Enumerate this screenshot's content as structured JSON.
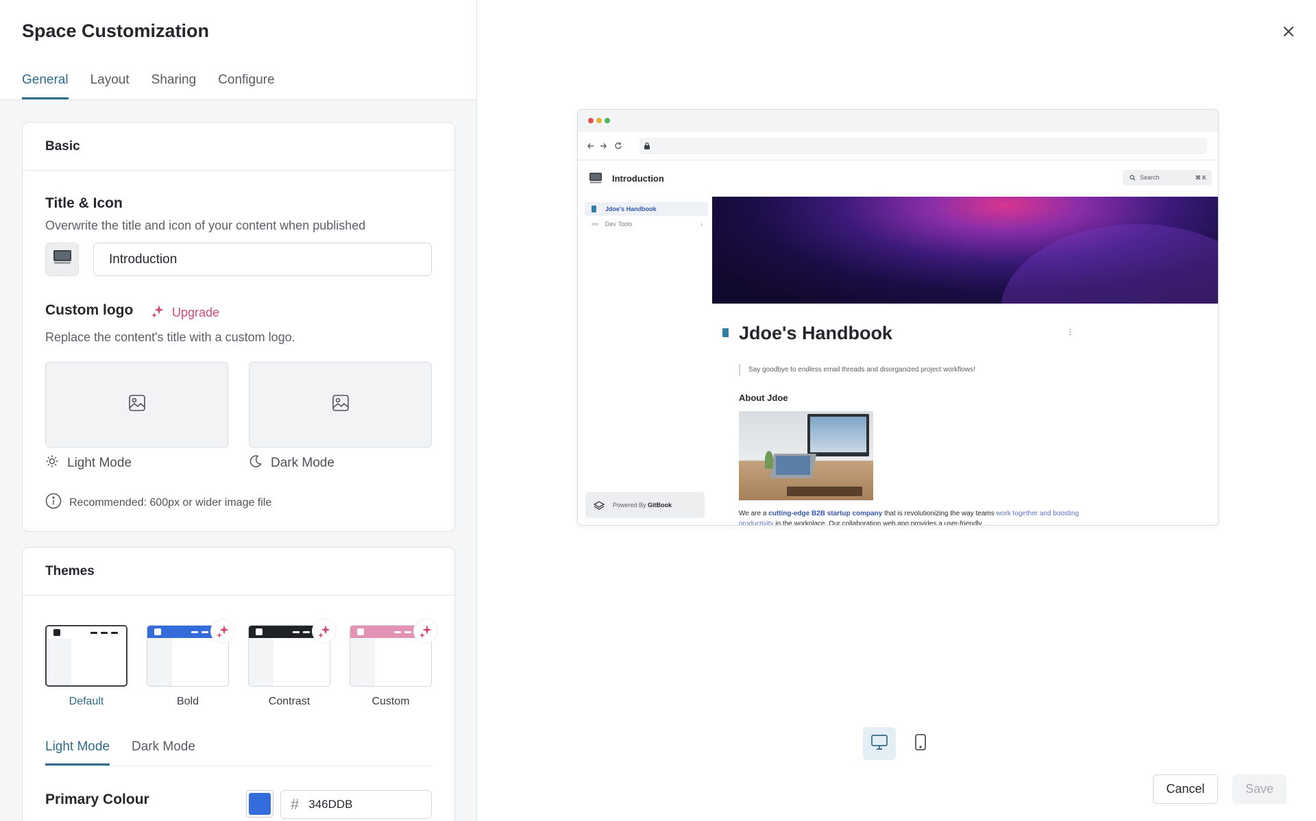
{
  "panel": {
    "title": "Space Customization",
    "tabs": [
      {
        "label": "General",
        "active": true
      },
      {
        "label": "Layout"
      },
      {
        "label": "Sharing"
      },
      {
        "label": "Configure"
      }
    ]
  },
  "basic": {
    "header": "Basic",
    "title_icon_heading": "Title & Icon",
    "title_icon_sub": "Overwrite the title and icon of your content when published",
    "title_value": "Introduction",
    "custom_logo_heading": "Custom logo",
    "upgrade_label": "Upgrade",
    "custom_logo_sub": "Replace the content's title with a custom logo.",
    "light_mode_label": "Light Mode",
    "dark_mode_label": "Dark Mode",
    "recommendation": "Recommended: 600px or wider image file"
  },
  "themes": {
    "header": "Themes",
    "options": [
      {
        "label": "Default",
        "selected": true
      },
      {
        "label": "Bold"
      },
      {
        "label": "Contrast"
      },
      {
        "label": "Custom"
      }
    ],
    "mode_tabs": [
      {
        "label": "Light Mode",
        "active": true
      },
      {
        "label": "Dark Mode"
      }
    ],
    "primary_colour_label": "Primary Colour",
    "primary_colour_hex": "346DDB",
    "primary_colour": "#346DDB"
  },
  "preview": {
    "site_title": "Introduction",
    "search_placeholder": "Search",
    "search_shortcut": "⌘ K",
    "nav_items": [
      "Jdoe's Handbook",
      "Dev Tools"
    ],
    "powered_by_prefix": "Powered By ",
    "powered_by_brand": "GitBook",
    "page_title": "Jdoe's Handbook",
    "quote": "Say goodbye to endless email threads and disorganized project workflows!",
    "section_heading": "About Jdoe",
    "para_1": "We are a ",
    "para_bold": "cutting-edge B2B startup company",
    "para_2": " that is revolutionizing the way teams ",
    "para_link": "work together and boosting productivity",
    "para_3": " in the workplace. Our collaboration web app provides a user-friendly"
  },
  "footer": {
    "cancel_label": "Cancel",
    "save_label": "Save"
  },
  "colors": {
    "accent": "#2f6b8a",
    "upgrade": "#d1477a",
    "bold_theme": "#346DDB",
    "contrast_theme": "#1f2328",
    "custom_theme": "#e394b6"
  }
}
